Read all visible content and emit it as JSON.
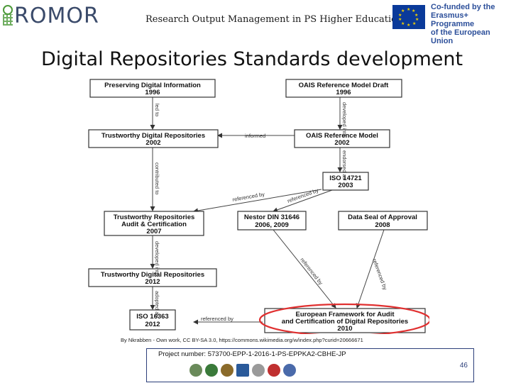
{
  "header": {
    "logo_text": "ROMOR",
    "title": "Research Output Management in PS Higher Education",
    "eu_line1": "Co-funded by the",
    "eu_line2": "Erasmus+ Programme",
    "eu_line3": "of the European Union"
  },
  "slide": {
    "title": "Digital Repositories Standards development"
  },
  "diagram": {
    "boxes": {
      "pdi": {
        "name": "Preserving Digital Information",
        "year": "1996"
      },
      "oais_draft": {
        "name": "OAIS Reference Model Draft",
        "year": "1996"
      },
      "tdr2002": {
        "name": "Trustworthy Digital Repositories",
        "year": "2002"
      },
      "oais2002": {
        "name": "OAIS Reference Model",
        "year": "2002"
      },
      "iso14721": {
        "name": "ISO 14721",
        "year": "2003"
      },
      "tdrac_line1": "Trustworthy Repositories",
      "tdrac_line2": "Audit & Certification",
      "tdrac_year": "2007",
      "nestor_name": "Nestor DIN 31646",
      "nestor_year": "2006, 2009",
      "dsa": {
        "name": "Data Seal of Approval",
        "year": "2008"
      },
      "tdr2012": {
        "name": "Trustworthy Digital Repositories",
        "year": "2012"
      },
      "iso16363": {
        "name": "ISO 16363",
        "year": "2012"
      },
      "ef_line1": "European Framework for Audit",
      "ef_line2": "and Certification of Digital Repositories",
      "ef_year": "2010"
    },
    "labels": {
      "informed": "informed",
      "led_to": "led to",
      "developed_into_1": "developed into",
      "endorsed_as": "endorsed as",
      "contributed_to": "contributed to",
      "referenced_by_1": "referenced by",
      "referenced_by_2": "referenced by",
      "referenced_by_3": "referenced by",
      "developed_into_2": "developed into",
      "adopted_as": "adopted as",
      "referenced_by_4": "referenced by",
      "referenced_by_5": "referenced by"
    }
  },
  "caption": "By Nkrabben - Own work, CC BY-SA 3.0, https://commons.wikimedia.org/w/index.php?curid=20666671",
  "footer": {
    "project": "Project number: 573700-EPP-1-2016-1-PS-EPPKA2-CBHE-JP",
    "page": "46"
  },
  "colors": {
    "highlight_ellipse": "#e03030",
    "footer_border": "#2c3f7a",
    "eu_blue": "#0a3a9a"
  }
}
